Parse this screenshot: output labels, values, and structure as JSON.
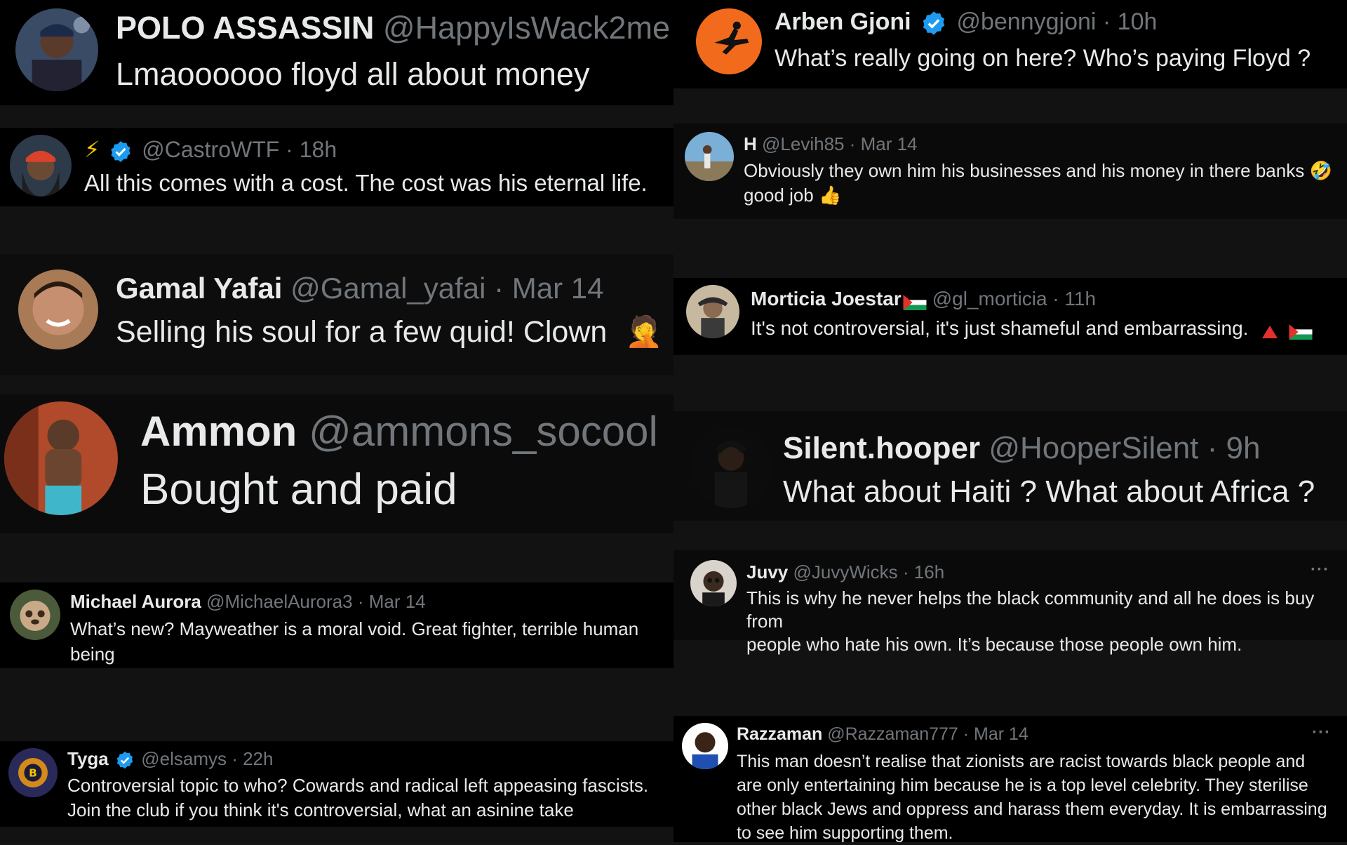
{
  "left": [
    {
      "name": "POLO ASSASSIN",
      "handle": "@HappyIsWack2me",
      "text": "Lmaoooooo floyd all about money"
    },
    {
      "name": "",
      "handle": "@CastroWTF · 18h",
      "text": "All this comes with a cost. The cost was his eternal life.",
      "name_emoji": "⚡"
    },
    {
      "name": "Gamal Yafai",
      "handle": "@Gamal_yafai · Mar 14",
      "text": "Selling his soul for a few quid! Clown",
      "emoji": "🤦"
    },
    {
      "name": "Ammon",
      "handle": "@ammons_socool",
      "text": "Bought and paid"
    },
    {
      "name": "Michael Aurora",
      "handle": "@MichaelAurora3 · Mar 14",
      "text_line1": "What’s new? Mayweather is a moral void. Great fighter, terrible human",
      "text_line2": "being"
    },
    {
      "name": "Tyga",
      "handle": "@elsamys · 22h",
      "text_line1": "Controversial topic to who? Cowards and radical left appeasing fascists.",
      "text_line2": "Join the club if you think it's controversial, what an asinine take"
    }
  ],
  "right": [
    {
      "name": "Arben Gjoni",
      "handle": "@bennygjoni · 10h",
      "text": "What’s really going on here? Who’s paying Floyd ?"
    },
    {
      "name": "H",
      "handle": "@Levih85 · Mar 14",
      "text_line1": "Obviously they own him his businesses and his money in there banks",
      "text_line2": "good job",
      "emoji1": "🤣",
      "emoji2": "👍"
    },
    {
      "name": "Morticia Joestar",
      "handle": "@gl_morticia · 11h",
      "text": "It's not controversial, it's just shameful and embarrassing."
    },
    {
      "name": "Silent.hooper",
      "handle": "@HooperSilent · 9h",
      "text": "What about Haiti ? What about Africa ?"
    },
    {
      "name": "Juvy",
      "handle": "@JuvyWicks · 16h",
      "text_line1": "This is why he never helps the black community and all he does is buy from",
      "text_line2": "people who hate his own. It’s because those people own him.",
      "more": "···"
    },
    {
      "name": "Razzaman",
      "handle": "@Razzaman777 · Mar 14",
      "text_line1": "This man doesn’t realise that zionists are racist towards black people and",
      "text_line2": "are only entertaining him because he is a top level celebrity. They sterilise",
      "text_line3": "other black Jews and oppress and harass them everyday. It is embarrassing",
      "text_line4": "to see him supporting them.",
      "more": "···"
    }
  ],
  "colors": {
    "background": "#000000",
    "gap": "#121212",
    "text": "#e7e9ea",
    "handle": "#71767b",
    "verified": "#1d9bf0",
    "accent_orange": "#f26b1d"
  }
}
